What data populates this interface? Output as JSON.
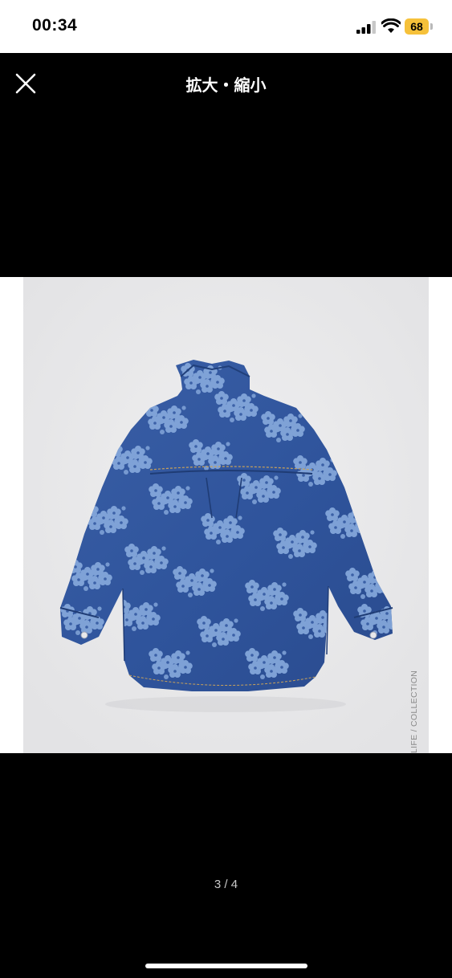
{
  "status_bar": {
    "time": "00:34",
    "battery_level": "68",
    "battery_color": "#f6c13a",
    "icons": [
      "cellular-signal-icon",
      "wifi-icon",
      "battery-icon"
    ]
  },
  "header": {
    "title": "拡大・縮小",
    "close_icon": "close-icon"
  },
  "image": {
    "subject": "denim shirt with floral print, back view",
    "watermark": "LIFE / COLLECTION"
  },
  "pager": {
    "label": "3 / 4",
    "current": 3,
    "total": 4
  }
}
